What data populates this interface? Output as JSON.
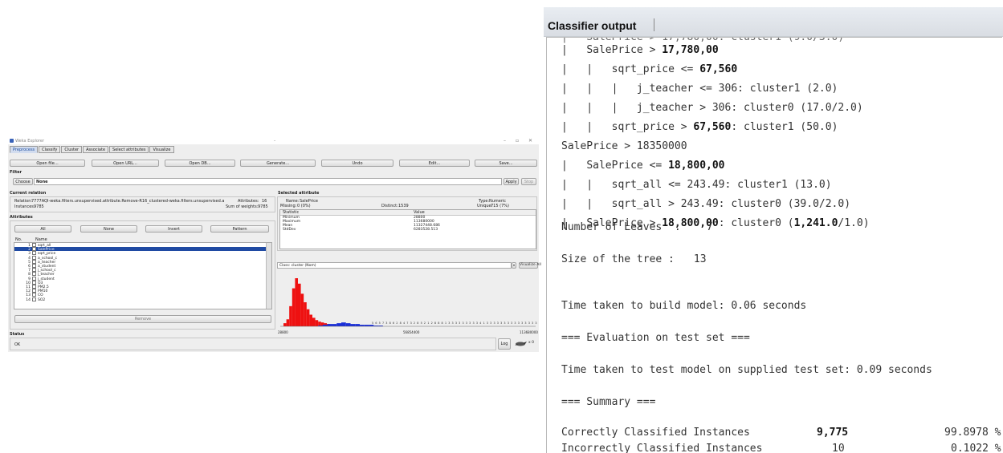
{
  "weka": {
    "window_title": "Weka Explorer",
    "title_dash": "-",
    "window_controls": {
      "minimize": "–",
      "restore": "▫",
      "close": "✕"
    },
    "tabs": [
      {
        "label": "Preprocess",
        "active": true
      },
      {
        "label": "Classify",
        "active": false
      },
      {
        "label": "Cluster",
        "active": false
      },
      {
        "label": "Associate",
        "active": false
      },
      {
        "label": "Select attributes",
        "active": false
      },
      {
        "label": "Visualize",
        "active": false
      }
    ],
    "toolbar": {
      "open_file": "Open file...",
      "open_url": "Open URL...",
      "open_db": "Open DB...",
      "generate": "Generate...",
      "undo": "Undo",
      "edit": "Edit...",
      "save": "Save..."
    },
    "filter": {
      "section_label": "Filter",
      "choose_label": "Choose",
      "value": "None",
      "apply_label": "Apply",
      "stop_label": "Stop"
    },
    "current_relation": {
      "section_label": "Current relation",
      "relation_label": "Relation:",
      "relation_value": "7777AQI-weka.filters.unsupervised.attribute.Remove-R16_clustered-weka.filters.unsupervised.attribute.Remov...",
      "attributes_label": "Attributes:",
      "attributes_value": "16",
      "instances_label": "Instances:",
      "instances_value": "9785",
      "sum_weights_label": "Sum of weights:",
      "sum_weights_value": "9785"
    },
    "attributes": {
      "section_label": "Attributes",
      "all_label": "All",
      "none_label": "None",
      "invert_label": "Invert",
      "pattern_label": "Pattern",
      "col_no": "No.",
      "col_name": "Name",
      "rows": [
        {
          "no": "1",
          "name": "sqrt_all",
          "selected": false
        },
        {
          "no": "2",
          "name": "SalePrice",
          "selected": true
        },
        {
          "no": "3",
          "name": "sqrt_price",
          "selected": false
        },
        {
          "no": "4",
          "name": "a_school_c",
          "selected": false
        },
        {
          "no": "5",
          "name": "a_teacher",
          "selected": false
        },
        {
          "no": "6",
          "name": "a_student",
          "selected": false
        },
        {
          "no": "7",
          "name": "j_school_c",
          "selected": false
        },
        {
          "no": "8",
          "name": "j_teacher",
          "selected": false
        },
        {
          "no": "9",
          "name": "j_student",
          "selected": false
        },
        {
          "no": "10",
          "name": "O3",
          "selected": false
        },
        {
          "no": "11",
          "name": "PM2.5",
          "selected": false
        },
        {
          "no": "12",
          "name": "PM10",
          "selected": false
        },
        {
          "no": "13",
          "name": "CO",
          "selected": false
        },
        {
          "no": "14",
          "name": "SO2",
          "selected": false
        }
      ],
      "remove_label": "Remove"
    },
    "selected_attribute": {
      "section_label": "Selected attribute",
      "name_label": "Name:",
      "name_value": "SalePrice",
      "type_label": "Type:",
      "type_value": "Numeric",
      "missing_label": "Missing:",
      "missing_value": "0 (0%)",
      "distinct_label": "Distinct:",
      "distinct_value": "1539",
      "unique_label": "Unique:",
      "unique_value": "715 (7%)",
      "col_statistic": "Statistic",
      "col_value": "Value",
      "stats": [
        {
          "k": "Minimum",
          "v": "28800"
        },
        {
          "k": "Maximum",
          "v": "113680000"
        },
        {
          "k": "Mean",
          "v": "11327448.686"
        },
        {
          "k": "StdDev",
          "v": "6283528.513"
        }
      ],
      "class_label": "Class: cluster (Nom)",
      "visualize_all_label": "Visualize All",
      "hist_left_label": "28800",
      "hist_mid_label": "56854400",
      "hist_right_label": "113680000",
      "hist_counts_text": "5 6 5 7 3 8  6 2 8 4 7 3 2 8 5 2 1 2 8 8 8 1 3 3 3 3 3 3 3 3 3 4 1 3 3 3 3 3 3 3 3 3 3 3 3 3 3 3 3 2 2 2 2 3",
      "hist_red": [
        4,
        9,
        26,
        49,
        62,
        55,
        42,
        31,
        22,
        15,
        11,
        8,
        6,
        5,
        4,
        3
      ],
      "hist_blue": [
        1,
        2,
        3,
        3,
        4,
        5,
        4,
        3,
        3,
        2,
        2,
        2,
        1,
        1
      ],
      "colors": {
        "red": "#ee1111",
        "blue": "#1a2fd8"
      }
    },
    "status": {
      "section_label": "Status",
      "value": "OK",
      "log_label": "Log",
      "x_label": "x 0"
    }
  },
  "classifier": {
    "title": "Classifier output",
    "tree_lines": [
      {
        "prefix": "|   ",
        "text": "SalePrice > ",
        "num": "17,780,00",
        "suffix": ""
      },
      {
        "prefix": "|   |   ",
        "text": "sqrt_price <= ",
        "num": "67,560",
        "suffix": ""
      },
      {
        "prefix": "|   |   |   ",
        "text": "j_teacher <= 306: cluster1 (2.0)",
        "num": "",
        "suffix": ""
      },
      {
        "prefix": "|   |   |   ",
        "text": "j_teacher > 306: cluster0 (17.0/2.0)",
        "num": "",
        "suffix": ""
      },
      {
        "prefix": "|   |   ",
        "text": "sqrt_price > ",
        "num": "67,560",
        "suffix": ": cluster1 (50.0)"
      },
      {
        "prefix": "",
        "text": "SalePrice > 18350000",
        "num": "",
        "suffix": ""
      },
      {
        "prefix": "|   ",
        "text": "SalePrice <= ",
        "num": "18,800,00",
        "suffix": ""
      },
      {
        "prefix": "|   |   ",
        "text": "sqrt_all <= 243.49: cluster1 (13.0)",
        "num": "",
        "suffix": ""
      },
      {
        "prefix": "|   |   ",
        "text": "sqrt_all > 243.49: cluster0 (39.0/2.0)",
        "num": "",
        "suffix": ""
      },
      {
        "prefix": "|   ",
        "text": "SalePrice > ",
        "num": "18,800,00",
        "suffix": ": cluster0 (",
        "num2": "1,241.0",
        "suffix2": "/1.0)"
      }
    ],
    "leaves_label": "Number of Leaves  :",
    "leaves_value": "7",
    "size_label": "Size of the tree :",
    "size_value": "13",
    "build_time": "Time taken to build model: 0.06 seconds",
    "eval_header": "=== Evaluation on test set ===",
    "test_time": "Time taken to test model on supplied test set: 0.09 seconds",
    "summary_header": "=== Summary ===",
    "correct_label": "Correctly Classified Instances",
    "correct_count": "9,775",
    "correct_pct": "99.8978 %",
    "incorrect_label": "Incorrectly Classified Instances",
    "incorrect_count": "10",
    "incorrect_pct": "0.1022 %"
  }
}
